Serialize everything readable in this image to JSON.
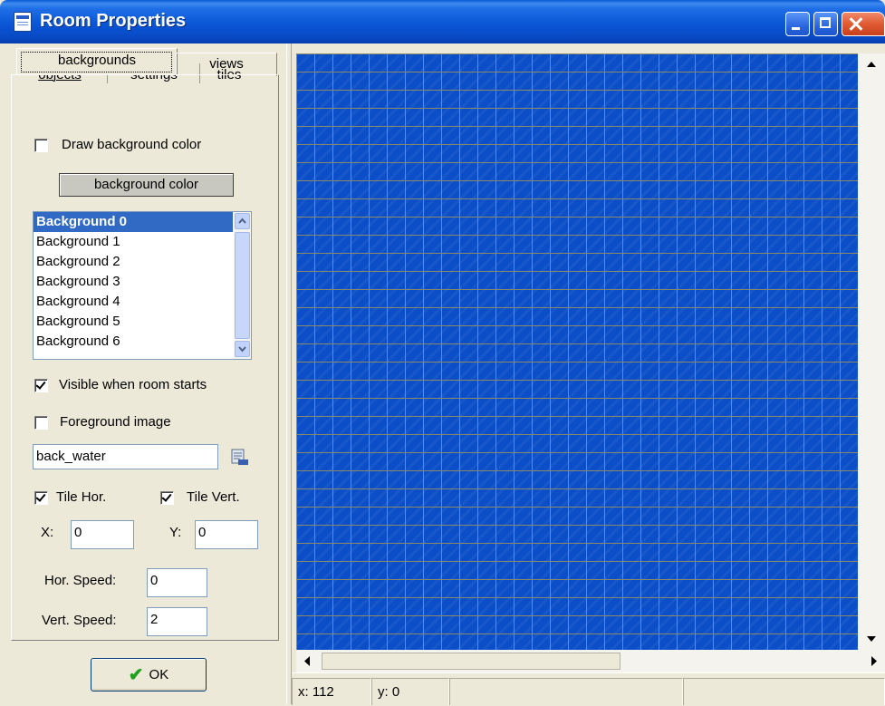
{
  "window": {
    "title": "Room Properties"
  },
  "tabs": {
    "objects": "objects",
    "settings": "settings",
    "tiles": "tiles",
    "backgrounds": "backgrounds",
    "views": "views"
  },
  "backgrounds_panel": {
    "draw_bg_color_label": "Draw background color",
    "draw_bg_color_checked": false,
    "bg_color_button": "background color",
    "list_items": [
      "Background 0",
      "Background 1",
      "Background 2",
      "Background 3",
      "Background 4",
      "Background 5",
      "Background 6"
    ],
    "selected_item": "Background 0",
    "visible_label": "Visible when room starts",
    "visible_checked": true,
    "foreground_label": "Foreground image",
    "foreground_checked": false,
    "image_name": "back_water",
    "tile_hor_label": "Tile Hor.",
    "tile_hor_checked": true,
    "tile_vert_label": "Tile Vert.",
    "tile_vert_checked": true,
    "x_label": "X:",
    "x_value": "0",
    "y_label": "Y:",
    "y_value": "0",
    "hor_speed_label": "Hor. Speed:",
    "hor_speed_value": "0",
    "vert_speed_label": "Vert. Speed:",
    "vert_speed_value": "2"
  },
  "ok_button": "OK",
  "status": {
    "x": "x: 112",
    "y": "y: 0"
  },
  "colors": {
    "canvas_blue": "#0b4ec7",
    "grid_line": "#8a8a6a",
    "selection": "#316ac5"
  }
}
